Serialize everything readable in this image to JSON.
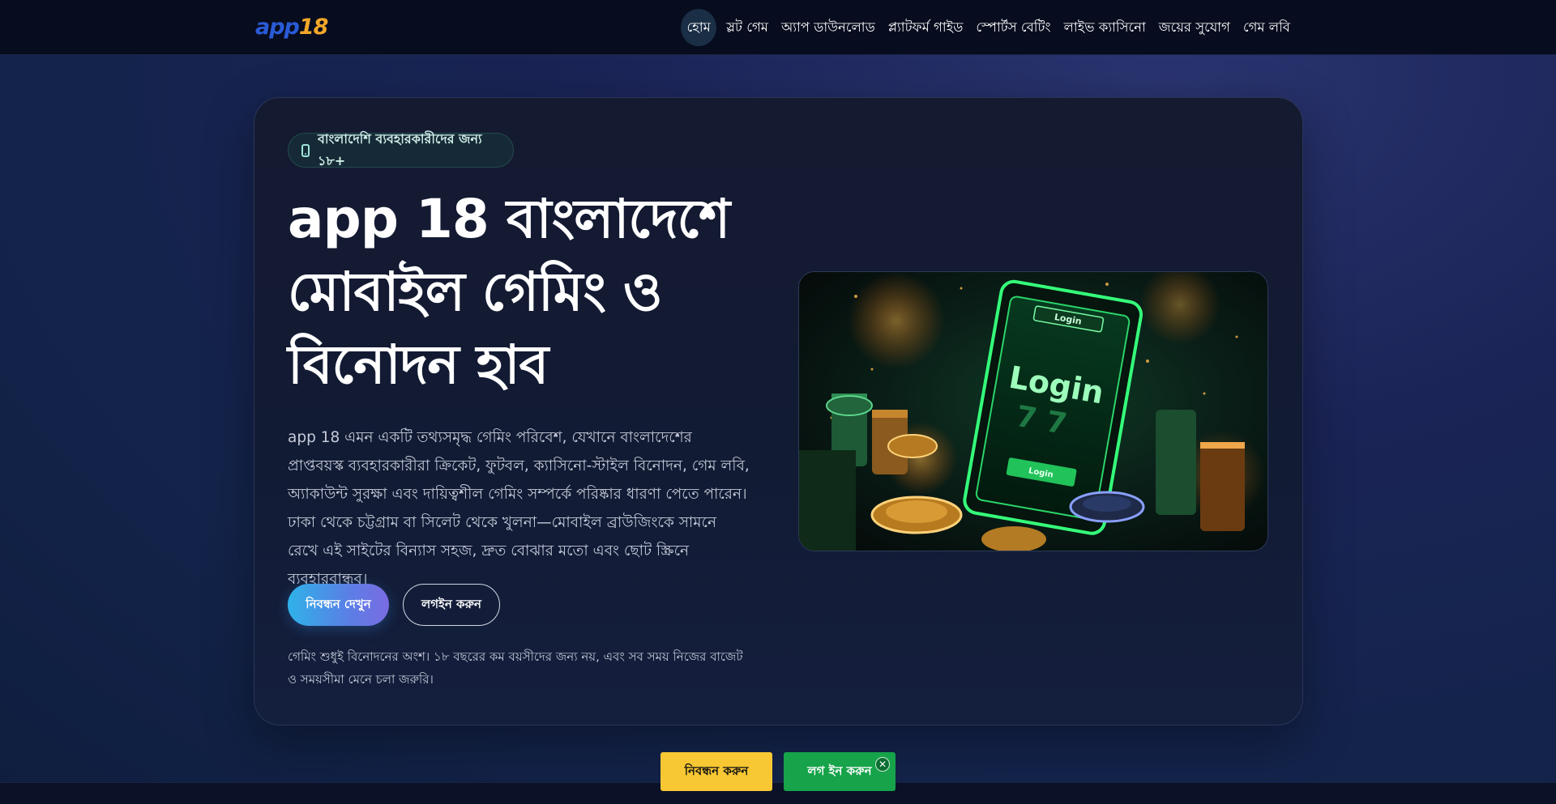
{
  "header": {
    "logo_part1": "app",
    "logo_part2": "18",
    "nav": [
      {
        "label": "হোম"
      },
      {
        "label": "স্লট গেম"
      },
      {
        "label": "অ্যাপ ডাউনলোড"
      },
      {
        "label": "প্ল্যাটফর্ম গাইড"
      },
      {
        "label": "স্পোর্টস বেটিং"
      },
      {
        "label": "লাইভ ক্যাসিনো"
      },
      {
        "label": "জয়ের সুযোগ"
      },
      {
        "label": "গেম লবি"
      }
    ]
  },
  "hero": {
    "badge": "বাংলাদেশি ব্যবহারকারীদের জন্য ১৮+",
    "title": "app 18 বাংলাদেশে মোবাইল গেমিং ও বিনোদন হাব",
    "description": "app 18 এমন একটি তথ্যসমৃদ্ধ গেমিং পরিবেশ, যেখানে বাংলাদেশের প্রাপ্তবয়স্ক ব্যবহারকারীরা ক্রিকেট, ফুটবল, ক্যাসিনো-স্টাইল বিনোদন, গেম লবি, অ্যাকাউন্ট সুরক্ষা এবং দায়িত্বশীল গেমিং সম্পর্কে পরিষ্কার ধারণা পেতে পারেন। ঢাকা থেকে চট্টগ্রাম বা সিলেট থেকে খুলনা—মোবাইল ব্রাউজিংকে সামনে রেখে এই সাইটের বিন্যাস সহজ, দ্রুত বোঝার মতো এবং ছোট স্ক্রিনে ব্যবহারবান্ধব।",
    "primary_button": "নিবন্ধন দেখুন",
    "secondary_button": "লগইন করুন",
    "disclaimer": "গেমিং শুধুই বিনোদনের অংশ। ১৮ বছরের কম বয়সীদের জন্য নয়, এবং সব সময় নিজের বাজেট ও সময়সীমা মেনে চলা জরুরি।",
    "image_text_top": "Login",
    "image_text_main": "Login",
    "image_text_button": "Login"
  },
  "sticky": {
    "register": "নিবন্ধন করুন",
    "login": "লগ ইন করুন",
    "close": "✕"
  },
  "colors": {
    "accent_yellow": "#f7c833",
    "accent_green": "#16a34a",
    "gradient_blue": "#2fb2e8",
    "gradient_purple": "#7a6be2"
  }
}
